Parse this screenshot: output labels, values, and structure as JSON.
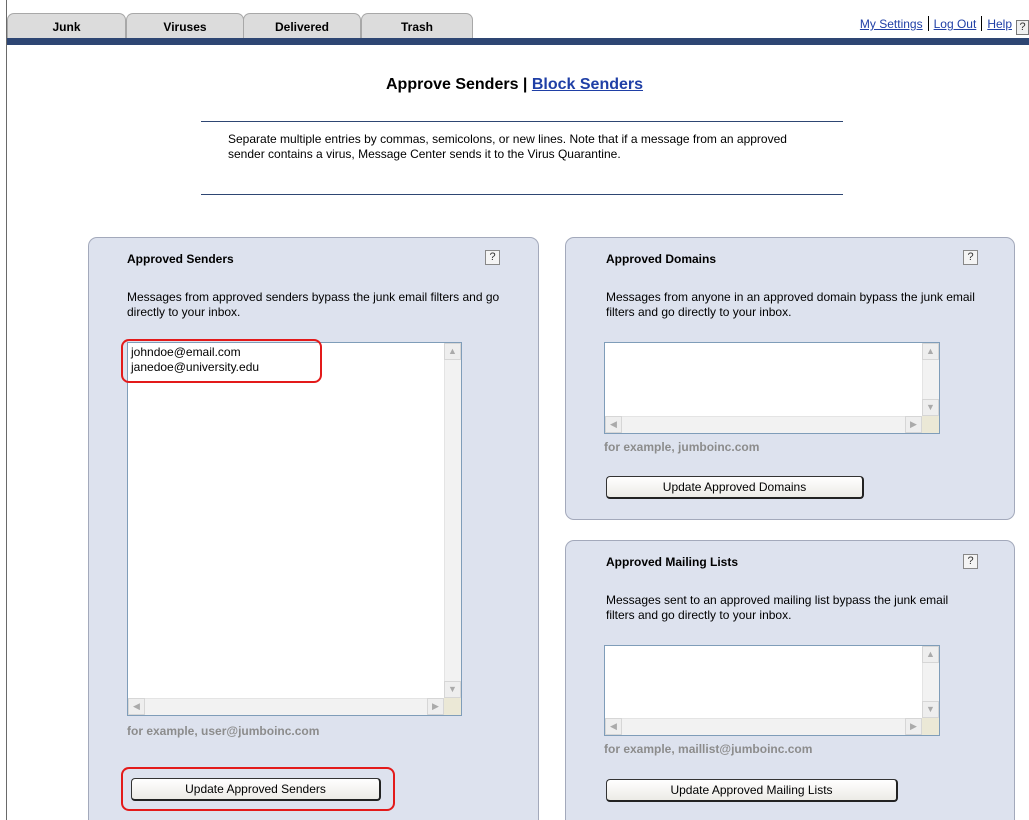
{
  "tabs": [
    "Junk",
    "Viruses",
    "Delivered",
    "Trash"
  ],
  "toplinks": {
    "settings": "My Settings",
    "logout": "Log Out",
    "help": "Help",
    "help_icon": "?"
  },
  "header": {
    "approve": "Approve Senders",
    "separator": "|",
    "block": "Block Senders"
  },
  "note": "Separate multiple entries by commas, semicolons, or new lines. Note that if a message from an approved sender contains a virus, Message Center sends it to the Virus Quarantine.",
  "senders": {
    "title": "Approved Senders",
    "help": "?",
    "desc": "Messages from approved senders bypass the junk email filters and go directly to your inbox.",
    "entries": [
      "johndoe@email.com",
      "janedoe@university.edu"
    ],
    "example": "for example, user@jumboinc.com",
    "button": "Update Approved Senders"
  },
  "domains": {
    "title": "Approved Domains",
    "help": "?",
    "desc": "Messages from anyone in an approved domain bypass the junk email filters and go directly to your inbox.",
    "example": "for example, jumboinc.com",
    "button": "Update Approved Domains"
  },
  "lists": {
    "title": "Approved Mailing Lists",
    "help": "?",
    "desc": "Messages sent to an approved mailing list bypass the junk email filters and go directly to your inbox.",
    "example": "for example, maillist@jumboinc.com",
    "button": "Update Approved Mailing Lists"
  },
  "colors": {
    "nav_bar": "#2e4673",
    "panel_bg": "#dde2ee",
    "link": "#1f3fa6",
    "highlight": "#e31a1a"
  }
}
